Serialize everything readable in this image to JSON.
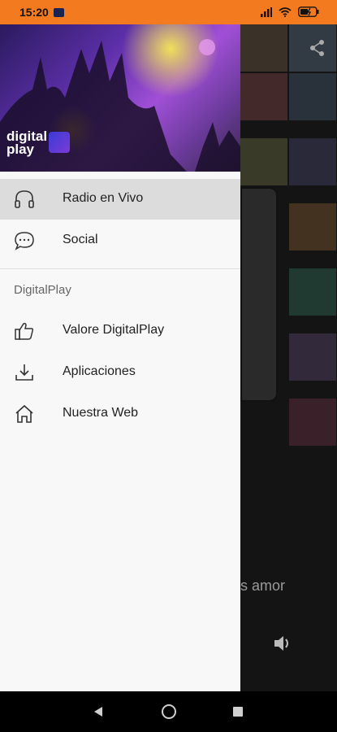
{
  "status_bar": {
    "time": "15:20",
    "app_icon": "tv-icon",
    "signal_icon": "cellular-signal-icon",
    "wifi_icon": "wifi-icon",
    "battery_icon": "battery-charging-icon"
  },
  "drawer": {
    "brand_name": "digital play",
    "items": [
      {
        "label": "Radio en Vivo",
        "icon": "headphones-icon",
        "active": true
      },
      {
        "label": "Social",
        "icon": "chat-bubble-icon",
        "active": false
      }
    ],
    "section_title": "DigitalPlay",
    "section_items": [
      {
        "label": "Valore DigitalPlay",
        "icon": "thumbs-up-icon"
      },
      {
        "label": "Aplicaciones",
        "icon": "download-icon"
      },
      {
        "label": "Nuestra Web",
        "icon": "home-icon"
      }
    ]
  },
  "background": {
    "lyric_fragment": "s amor",
    "share_icon": "share-icon",
    "volume_icon": "volume-icon"
  },
  "nav_bar": {
    "back_icon": "back-icon",
    "home_icon": "home-circle-icon",
    "recents_icon": "recents-icon"
  },
  "colors": {
    "status_bar": "#f47a1f",
    "drawer_bg": "#f8f8f8",
    "active_item_bg": "#dcdcdc"
  }
}
